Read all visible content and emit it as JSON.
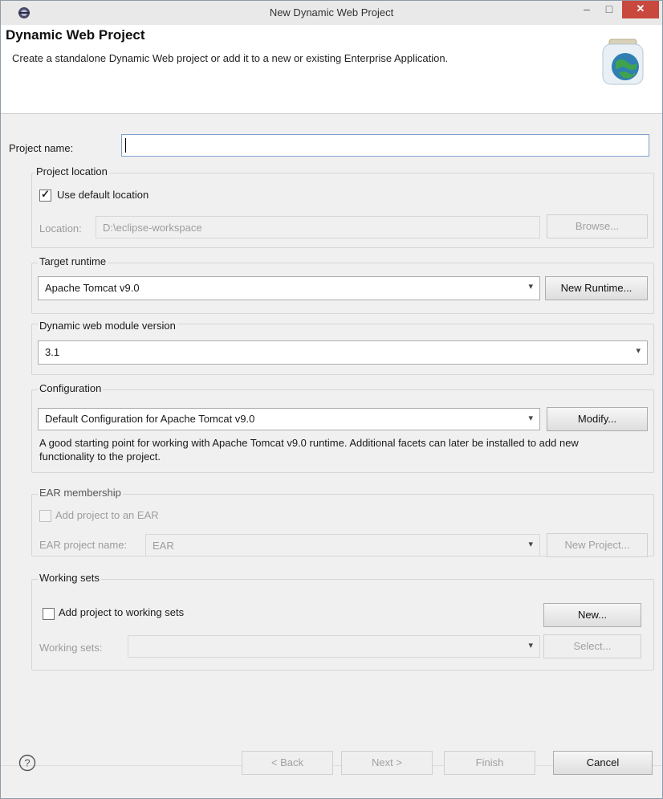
{
  "window": {
    "title": "New Dynamic Web Project",
    "minimize_glyph": "–",
    "maximize_glyph": "□",
    "close_glyph": "✕"
  },
  "header": {
    "title": "Dynamic Web Project",
    "description": "Create a standalone Dynamic Web project or add it to a new or existing Enterprise Application.",
    "icon": "web-project-globe-jar-icon"
  },
  "project_name": {
    "label": "Project name:",
    "value": ""
  },
  "project_location": {
    "legend": "Project location",
    "use_default_label": "Use default location",
    "use_default_checked": true,
    "location_label": "Location:",
    "location_value": "D:\\eclipse-workspace",
    "browse_label": "Browse..."
  },
  "target_runtime": {
    "legend": "Target runtime",
    "value": "Apache Tomcat v9.0",
    "new_runtime_label": "New Runtime..."
  },
  "module_version": {
    "legend": "Dynamic web module version",
    "value": "3.1"
  },
  "configuration": {
    "legend": "Configuration",
    "value": "Default Configuration for Apache Tomcat v9.0",
    "modify_label": "Modify...",
    "description": "A good starting point for working with Apache Tomcat v9.0 runtime. Additional facets can later be installed to add new functionality to the project."
  },
  "ear_membership": {
    "legend": "EAR membership",
    "add_to_ear_label": "Add project to an EAR",
    "add_to_ear_checked": false,
    "ear_name_label": "EAR project name:",
    "ear_name_value": "EAR",
    "new_project_label": "New Project..."
  },
  "working_sets": {
    "legend": "Working sets",
    "add_label": "Add project to working sets",
    "add_checked": false,
    "new_label": "New...",
    "sets_label": "Working sets:",
    "sets_value": "",
    "select_label": "Select..."
  },
  "footer": {
    "help_icon": "help-question-icon",
    "back_label": "< Back",
    "next_label": "Next >",
    "finish_label": "Finish",
    "cancel_label": "Cancel"
  }
}
